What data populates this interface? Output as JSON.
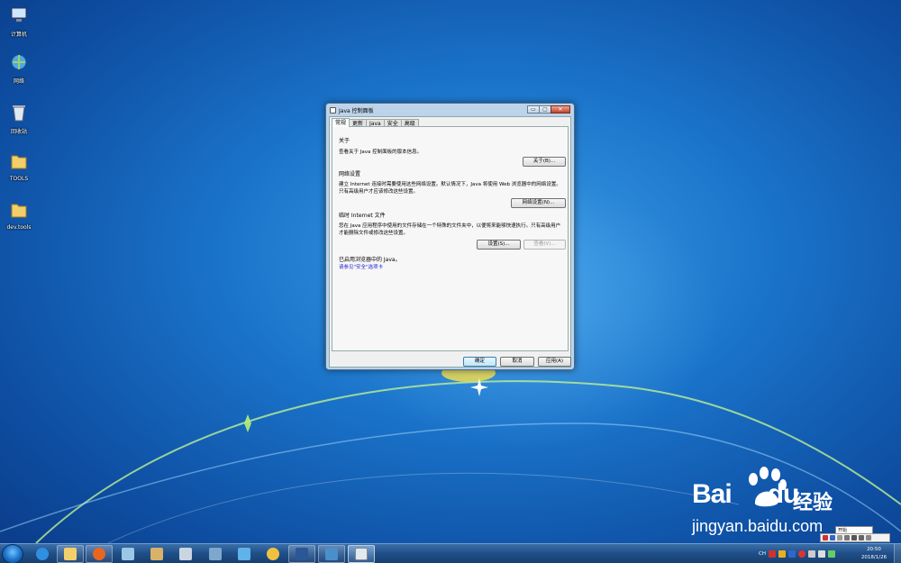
{
  "desktop": {
    "icons": [
      {
        "label": "计算机",
        "icon": "computer-icon"
      },
      {
        "label": "网络",
        "icon": "network-icon"
      },
      {
        "label": "回收站",
        "icon": "recycle-bin-icon"
      },
      {
        "label": "TOOLS",
        "icon": "folder-icon"
      },
      {
        "label": "dev.tools",
        "icon": "folder-icon"
      }
    ]
  },
  "window": {
    "title": "Java 控制面板",
    "buttons": {
      "minimize": "▭",
      "maximize": "▢",
      "close": "✕"
    },
    "tabs": [
      "常规",
      "更新",
      "Java",
      "安全",
      "高级"
    ],
    "active_tab": "常规",
    "sections": {
      "about": {
        "title": "关于",
        "text": "查看关于 Java 控制面板的版本信息。",
        "button": "关于(B)..."
      },
      "network": {
        "title": "网络设置",
        "text": "建立 Internet 连接时需要使用这些网络设置。默认情况下，Java 将使用 Web 浏览器中的网络设置。只有高级用户才应该修改这些设置。",
        "button": "网络设置(N)..."
      },
      "temp": {
        "title": "临时 Internet 文件",
        "text": "您在 Java 应用程序中使用的文件存储在一个特殊的文件夹中，以便将来能够快速执行。只有高级用户才能删除文件或修改这些设置。",
        "settings_button": "设置(S)...",
        "view_button": "查看(V)..."
      },
      "browser": {
        "text": "已启用浏览器中的 Java。",
        "link": "请参见\"安全\"选项卡"
      }
    },
    "footer": {
      "ok": "确定",
      "cancel": "取消",
      "apply": "应用(A)"
    }
  },
  "taskbar": {
    "items": [
      "ie-icon",
      "explorer-icon",
      "firefox-icon",
      "app-icon",
      "paint-icon",
      "calculator-icon",
      "network-tool-icon",
      "plane-icon",
      "search-tool-icon",
      "word-icon",
      "remote-desktop-icon",
      "java-icon"
    ],
    "tray_text": "CH",
    "clock_time": "20:50",
    "clock_date": "2018/1/26"
  },
  "langbar": {
    "tooltip": "开始"
  },
  "watermark": {
    "brand": "Bai",
    "brand2": "du",
    "cn": "经验",
    "url": "jingyan.baidu.com"
  },
  "colors": {
    "accent": "#3c7fb1",
    "link": "#1a1ad6",
    "taskbar": "#1f4f88"
  }
}
